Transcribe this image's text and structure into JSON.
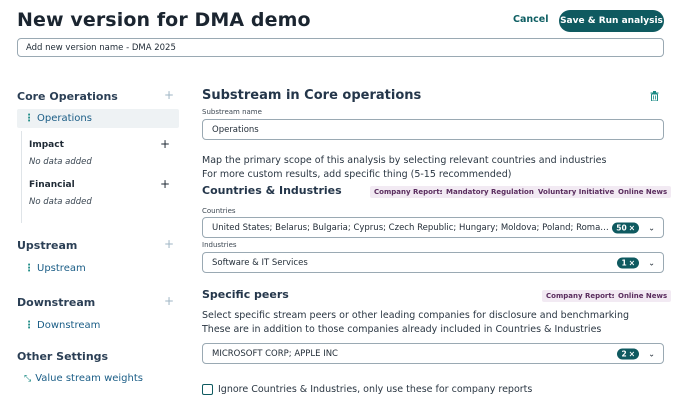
{
  "header": {
    "title": "New version for DMA demo",
    "cancel_label": "Cancel",
    "save_label": "Save & Run analysis",
    "version_name": "Add new version name - DMA 2025"
  },
  "sidebar": {
    "core": {
      "heading": "Core Operations",
      "item": "Operations",
      "impact": {
        "label": "Impact",
        "empty": "No data added"
      },
      "financial": {
        "label": "Financial",
        "empty": "No data added"
      }
    },
    "upstream": {
      "heading": "Upstream",
      "item": "Upstream"
    },
    "downstream": {
      "heading": "Downstream",
      "item": "Downstream"
    },
    "other": {
      "heading": "Other Settings",
      "item": "Value stream weights"
    }
  },
  "main": {
    "title": "Substream in Core operations",
    "substream_label": "Substream name",
    "substream_value": "Operations",
    "desc1": "Map the primary scope of this analysis by selecting relevant countries and industries",
    "desc2": "For more custom results, add specific thing (5-15 recommended)",
    "ci_heading": "Countries & Industries",
    "ci_tags": [
      "Company Reports",
      "Mandatory Regulations",
      "Voluntary Initiatives",
      "Online News"
    ],
    "countries_label": "Countries",
    "countries_value": "United States; Belarus; Bulgaria; Cyprus; Czech Republic; Hungary; Moldova; Poland; Romania; Rus...",
    "countries_count": "50",
    "industries_label": "Industries",
    "industries_value": "Software & IT Services",
    "industries_count": "1",
    "peers_heading": "Specific peers",
    "peers_tags": [
      "Company Reports",
      "Online News"
    ],
    "peers_desc1": "Select specific stream peers or other leading companies for disclosure and benchmarking",
    "peers_desc2": "These are in addition to those companies already included in Countries & Industries",
    "peers_value": "MICROSOFT CORP; APPLE INC",
    "peers_count": "2",
    "ignore_label": "Ignore Countries & Industries, only use these for company reports"
  },
  "colors": {
    "accent": "#0f5a60",
    "tag_bg": "#f2eaf3",
    "link": "#1a5d86"
  }
}
